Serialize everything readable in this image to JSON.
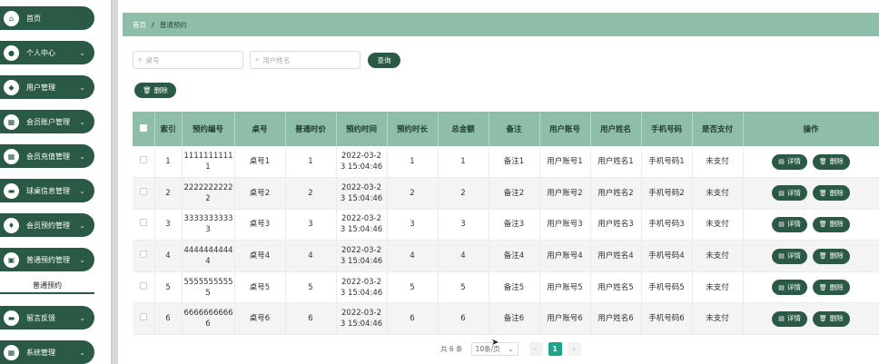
{
  "sidebar": {
    "items": [
      {
        "label": "首页",
        "icon": "home-icon",
        "glyph": "⌂",
        "chevron": false
      },
      {
        "label": "个人中心",
        "icon": "user-icon",
        "glyph": "●",
        "chevron": true
      },
      {
        "label": "用户管理",
        "icon": "users-icon",
        "glyph": "◆",
        "chevron": true
      },
      {
        "label": "会员账户管理",
        "icon": "grid-icon",
        "glyph": "▦",
        "chevron": true
      },
      {
        "label": "会员充值管理",
        "icon": "grid-icon",
        "glyph": "▦",
        "chevron": true
      },
      {
        "label": "球桌信息管理",
        "icon": "table-icon",
        "glyph": "▬",
        "chevron": true
      },
      {
        "label": "会员预约管理",
        "icon": "location-icon",
        "glyph": "♦",
        "chevron": true
      },
      {
        "label": "普通预约管理",
        "icon": "clipboard-icon",
        "glyph": "▣",
        "chevron": true
      },
      {
        "label": "留言反馈",
        "icon": "message-icon",
        "glyph": "▬",
        "chevron": true
      },
      {
        "label": "系统管理",
        "icon": "grid-icon",
        "glyph": "▦",
        "chevron": true
      }
    ],
    "sub_item": "普通预约",
    "chevron_glyph": "⌄"
  },
  "breadcrumb": {
    "home": "首页",
    "sep": "/",
    "current": "普通预约"
  },
  "search": {
    "table_no_placeholder": "桌号",
    "user_name_placeholder": "用户姓名",
    "query_label": "查询",
    "delete_label": "删除"
  },
  "table": {
    "headers": [
      "索引",
      "预约编号",
      "桌号",
      "普通时价",
      "预约时间",
      "预约时长",
      "总金额",
      "备注",
      "用户账号",
      "用户姓名",
      "手机号码",
      "是否支付",
      "操作"
    ],
    "rows": [
      {
        "idx": "1",
        "no": "1111111111",
        "no2": "1",
        "table": "桌号1",
        "price": "1",
        "time": "2022-03-2",
        "time2": "3 15:04:46",
        "dur": "1",
        "total": "1",
        "note": "备注1",
        "account": "用户账号1",
        "name": "用户姓名1",
        "phone": "手机号码1",
        "paid": "未支付"
      },
      {
        "idx": "2",
        "no": "2222222222",
        "no2": "2",
        "table": "桌号2",
        "price": "2",
        "time": "2022-03-2",
        "time2": "3 15:04:46",
        "dur": "2",
        "total": "2",
        "note": "备注2",
        "account": "用户账号2",
        "name": "用户姓名2",
        "phone": "手机号码2",
        "paid": "未支付"
      },
      {
        "idx": "3",
        "no": "3333333333",
        "no2": "3",
        "table": "桌号3",
        "price": "3",
        "time": "2022-03-2",
        "time2": "3 15:04:46",
        "dur": "3",
        "total": "3",
        "note": "备注3",
        "account": "用户账号3",
        "name": "用户姓名3",
        "phone": "手机号码3",
        "paid": "未支付"
      },
      {
        "idx": "4",
        "no": "4444444444",
        "no2": "4",
        "table": "桌号4",
        "price": "4",
        "time": "2022-03-2",
        "time2": "3 15:04:46",
        "dur": "4",
        "total": "4",
        "note": "备注4",
        "account": "用户账号4",
        "name": "用户姓名4",
        "phone": "手机号码4",
        "paid": "未支付"
      },
      {
        "idx": "5",
        "no": "5555555555",
        "no2": "5",
        "table": "桌号5",
        "price": "5",
        "time": "2022-03-2",
        "time2": "3 15:04:46",
        "dur": "5",
        "total": "5",
        "note": "备注5",
        "account": "用户账号5",
        "name": "用户姓名5",
        "phone": "手机号码5",
        "paid": "未支付"
      },
      {
        "idx": "6",
        "no": "6666666666",
        "no2": "6",
        "table": "桌号6",
        "price": "6",
        "time": "2022-03-2",
        "time2": "3 15:04:46",
        "dur": "6",
        "total": "6",
        "note": "备注6",
        "account": "用户账号6",
        "name": "用户姓名6",
        "phone": "手机号码6",
        "paid": "未支付"
      }
    ],
    "detail_label": "详情",
    "delete_label": "删除"
  },
  "pagination": {
    "total": "共 6 条",
    "page_size": "10条/页",
    "prev": "‹",
    "current": "1",
    "next": "›"
  },
  "colors": {
    "primary": "#2a5a46",
    "header": "#8fbea8",
    "active_page": "#1fa38a"
  }
}
